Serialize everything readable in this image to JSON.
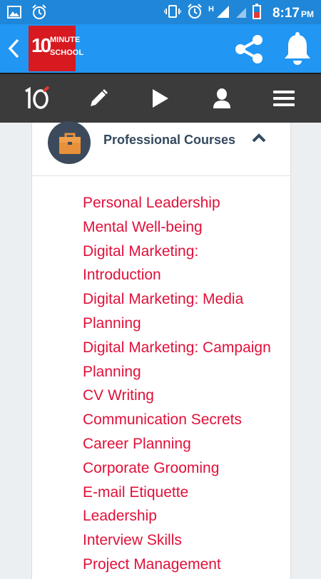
{
  "status_bar": {
    "time": "8:17",
    "ampm": "PM",
    "network": "H"
  },
  "app_bar": {
    "logo": {
      "number": "10",
      "line1": "MINUTE",
      "line2": "SCHOOL"
    },
    "accent": "#2196f3",
    "brand_red": "#d71920"
  },
  "nav_bar": {
    "items": [
      {
        "icon": "ten-logo-icon"
      },
      {
        "icon": "pencil-icon"
      },
      {
        "icon": "play-icon"
      },
      {
        "icon": "user-icon"
      },
      {
        "icon": "menu-icon"
      }
    ]
  },
  "section": {
    "title": "Professional Courses",
    "icon": "briefcase-icon"
  },
  "courses": [
    "Personal Leadership",
    "Mental Well-being",
    "Digital Marketing:",
    "Introduction",
    "Digital Marketing: Media",
    "Planning",
    "Digital Marketing: Campaign",
    "Planning",
    "CV Writing",
    "Communication Secrets",
    "Career Planning",
    "Corporate Grooming",
    "E-mail Etiquette",
    "Leadership",
    "Interview Skills",
    "Project Management"
  ]
}
